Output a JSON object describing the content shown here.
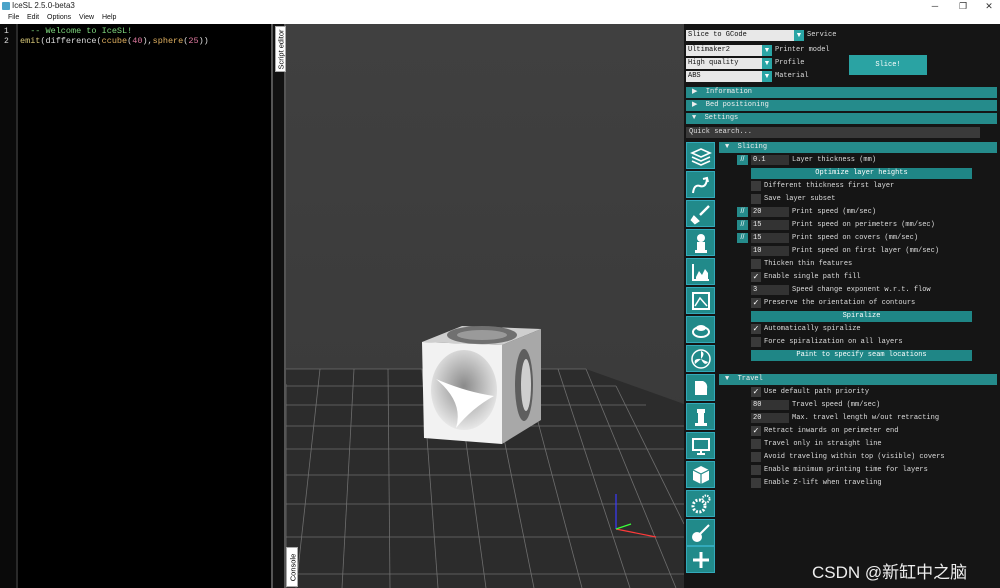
{
  "window": {
    "title": "IceSL 2.5.0-beta3",
    "minimize": "─",
    "maximize": "❐",
    "close": "✕"
  },
  "menu": [
    "File",
    "Edit",
    "Options",
    "View",
    "Help"
  ],
  "editor": {
    "line_numbers": [
      "1",
      "2"
    ],
    "lines": {
      "comment": "  -- Welcome to IceSL!",
      "emit": "emit",
      "p1": "(difference(",
      "ccube": "ccube",
      "p2": "(",
      "n40": "40",
      "p3": "),",
      "sphere": "sphere",
      "p4": "(",
      "n25": "25",
      "p5": "))"
    }
  },
  "tabs": {
    "script_editor": "Script editor",
    "console": "Console"
  },
  "panel": {
    "slice_mode": "Slice to GCode",
    "service_label": "Service",
    "printer": {
      "value": "Ultimaker2",
      "label": "Printer model"
    },
    "profile": {
      "value": "High quality",
      "label": "Profile"
    },
    "material": {
      "value": "ABS",
      "label": "Material"
    },
    "slice_button": "Slice!",
    "sections": {
      "information": "Information",
      "bed": "Bed positioning",
      "settings": "Settings"
    },
    "arrows": {
      "collapsed": "▶",
      "expanded": "▼"
    },
    "search_placeholder": "Quick search...",
    "dropdown_arrow": "▼",
    "link_glyph": "//",
    "check_glyph": "✓",
    "slicing": {
      "header": "Slicing",
      "layer_thickness": {
        "value": "0.1",
        "label": "Layer thickness (mm)"
      },
      "optimize_btn": "Optimize layer heights",
      "diff_first": "Different thickness first layer",
      "save_subset": "Save layer subset",
      "print_speed": {
        "value": "20",
        "label": "Print speed (mm/sec)"
      },
      "perimeters": {
        "value": "15",
        "label": "Print speed on perimeters (mm/sec)"
      },
      "covers": {
        "value": "15",
        "label": "Print speed on covers (mm/sec)"
      },
      "first_layer": {
        "value": "10",
        "label": "Print speed on first layer (mm/sec)"
      },
      "thicken": "Thicken thin features",
      "single_path": "Enable single path fill",
      "exponent": {
        "value": "3",
        "label": "Speed change exponent w.r.t. flow"
      },
      "preserve": "Preserve the orientation of contours",
      "spiralize_btn": "Spiralize",
      "auto_spiral": "Automatically spiralize",
      "force_spiral": "Force spiralization on all layers",
      "seam_btn": "Paint to specify seam locations"
    },
    "travel": {
      "header": "Travel",
      "default_priority": "Use default path priority",
      "travel_speed": {
        "value": "80",
        "label": "Travel speed (mm/sec)"
      },
      "max_travel": {
        "value": "20",
        "label": "Max. travel length w/out retracting"
      },
      "retract": "Retract inwards on perimeter end",
      "straight": "Travel only in straight line",
      "avoid": "Avoid traveling within top (visible) covers",
      "min_time": "Enable minimum printing time for layers",
      "zlift": "Enable Z-lift when traveling"
    }
  },
  "category_icons": [
    "layers-icon",
    "path-arrow-icon",
    "brush-icon",
    "figure-icon",
    "infill-icon",
    "image-frame-icon",
    "brim-icon",
    "fan-icon",
    "extruder-icon",
    "tower-icon",
    "monitor-icon",
    "cube-icon",
    "gears-icon",
    "guitar-icon",
    "plus-icon"
  ],
  "watermark": "CSDN @新缸中之脑"
}
